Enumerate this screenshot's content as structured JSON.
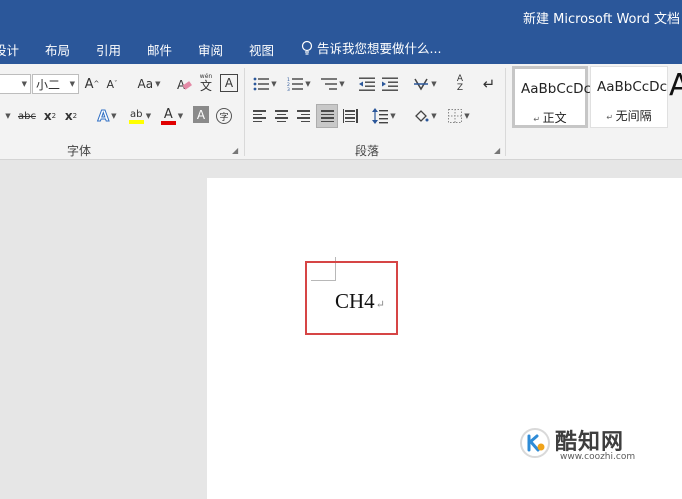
{
  "window": {
    "title": "新建 Microsoft Word 文档"
  },
  "tabs": [
    {
      "label": "设计"
    },
    {
      "label": "布局"
    },
    {
      "label": "引用"
    },
    {
      "label": "邮件"
    },
    {
      "label": "审阅"
    },
    {
      "label": "视图"
    }
  ],
  "tell_me": {
    "text": "告诉我您想要做什么..."
  },
  "font_group": {
    "label": "字体",
    "font_size": "小二",
    "grow": "A",
    "shrink": "A",
    "change_case": "Aa",
    "phonetic": "文",
    "phonetic_sub": "wén",
    "border_char": "A",
    "strike": "abc",
    "subscript": "x",
    "subscript_mark": "2",
    "superscript": "x",
    "superscript_mark": "2",
    "text_effect": "A",
    "highlighter": "ab",
    "font_color": "A",
    "shading_char": "A",
    "enclose_char": "字"
  },
  "paragraph_group": {
    "label": "段落",
    "sort": "A",
    "sort_sub": "Z"
  },
  "styles": [
    {
      "sample": "AaBbCcDc",
      "name": "正文",
      "selected": true
    },
    {
      "sample": "AaBbCcDc",
      "name": "无间隔",
      "selected": false
    }
  ],
  "styles_more": "A",
  "document": {
    "text": "CH4",
    "paragraph_mark": "↵"
  },
  "watermark": {
    "name": "酷知网",
    "url": "www.coozhi.com"
  },
  "colors": {
    "ribbon_tab_bar": "#2b579a",
    "highlight_border": "#d64545",
    "font_color_bar": "#e00000",
    "highlighter_bar": "#ffff00",
    "text_effect": "#2f6fc4"
  }
}
